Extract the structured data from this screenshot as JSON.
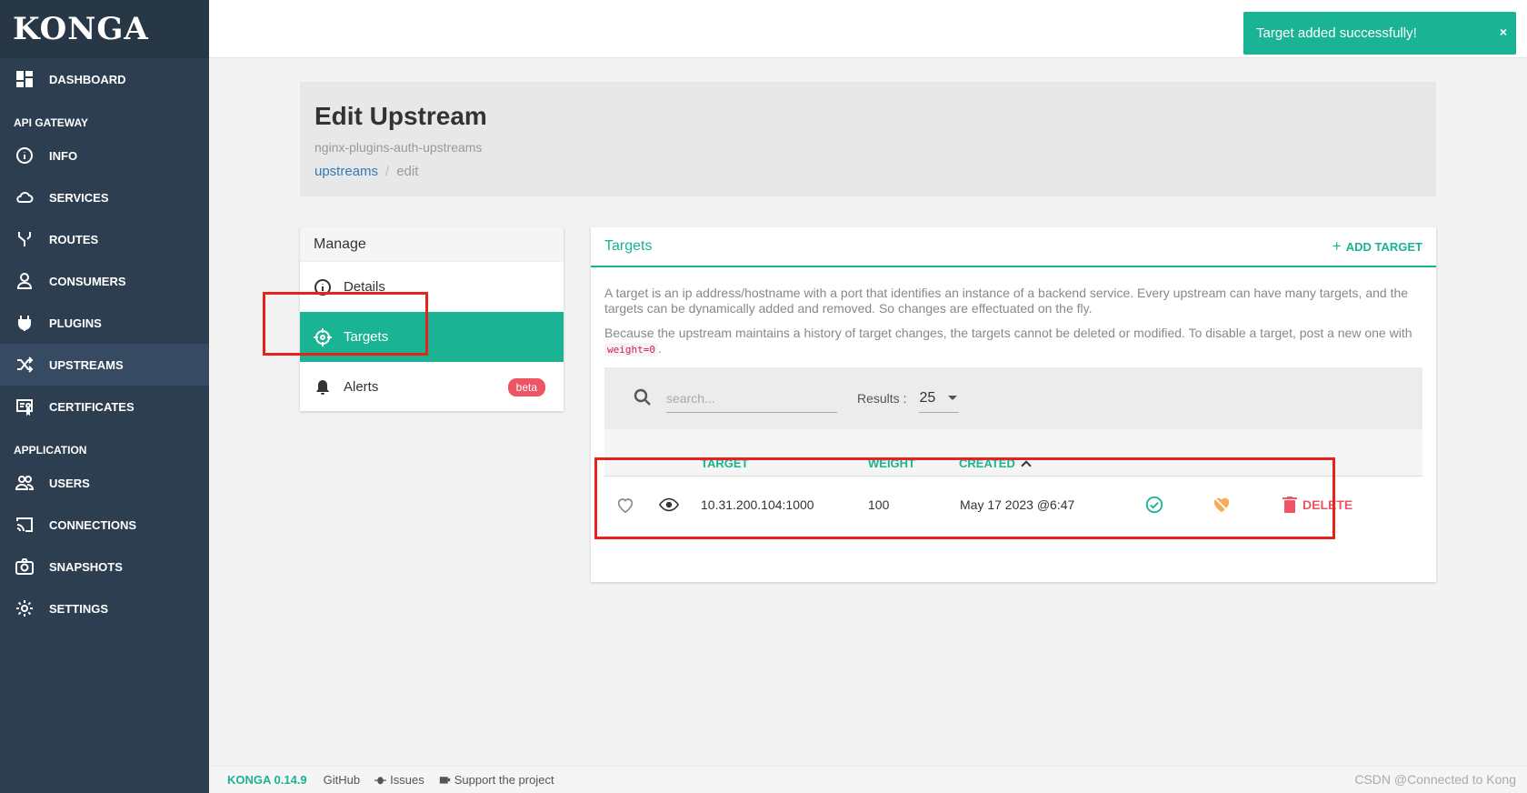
{
  "app": {
    "logo": "KONGA"
  },
  "sidebar": {
    "top": [
      {
        "label": "DASHBOARD",
        "icon": "dashboard-icon"
      }
    ],
    "section1": "API GATEWAY",
    "gateway": [
      {
        "label": "INFO",
        "icon": "info-icon"
      },
      {
        "label": "SERVICES",
        "icon": "cloud-icon"
      },
      {
        "label": "ROUTES",
        "icon": "routes-icon"
      },
      {
        "label": "CONSUMERS",
        "icon": "user-icon"
      },
      {
        "label": "PLUGINS",
        "icon": "plug-icon"
      },
      {
        "label": "UPSTREAMS",
        "icon": "shuffle-icon"
      },
      {
        "label": "CERTIFICATES",
        "icon": "certificate-icon"
      }
    ],
    "section2": "APPLICATION",
    "application": [
      {
        "label": "USERS",
        "icon": "users-icon"
      },
      {
        "label": "CONNECTIONS",
        "icon": "cast-icon"
      },
      {
        "label": "SNAPSHOTS",
        "icon": "camera-icon"
      },
      {
        "label": "SETTINGS",
        "icon": "gear-icon"
      }
    ]
  },
  "toast": {
    "message": "Target added successfully!",
    "close": "×"
  },
  "header": {
    "title": "Edit Upstream",
    "subtitle": "nginx-plugins-auth-upstreams",
    "breadcrumb": {
      "link": "upstreams",
      "current": "edit"
    }
  },
  "manage": {
    "title": "Manage",
    "items": [
      {
        "label": "Details",
        "icon": "info-icon"
      },
      {
        "label": "Targets",
        "icon": "crosshair-icon"
      },
      {
        "label": "Alerts",
        "icon": "bell-icon",
        "badge": "beta"
      }
    ]
  },
  "targets": {
    "title": "Targets",
    "add_label": "ADD TARGET",
    "add_plus": "+",
    "desc1": "A target is an ip address/hostname with a port that identifies an instance of a backend service. Every upstream can have many targets, and the targets can be dynamically added and removed. So changes are effectuated on the fly.",
    "desc2_pre": "Because the upstream maintains a history of target changes, the targets cannot be deleted or modified. To disable a target, post a new one with",
    "desc2_code": "weight=0",
    "desc2_post": ".",
    "search_placeholder": "search...",
    "results_label": "Results :",
    "results_value": "25",
    "columns": {
      "target": "TARGET",
      "weight": "WEIGHT",
      "created": "CREATED"
    },
    "rows": [
      {
        "target": "10.31.200.104:1000",
        "weight": "100",
        "created": "May 17 2023 @6:47",
        "delete": "DELETE"
      }
    ]
  },
  "footer": {
    "version": "KONGA 0.14.9",
    "github": "GitHub",
    "issues": "Issues",
    "support": "Support the project",
    "right": "CSDN @Connected to Kong"
  },
  "colors": {
    "sidebar": "#2d3e50",
    "accent": "#1ab394",
    "danger": "#ed5565",
    "annotation": "#e5231b"
  }
}
